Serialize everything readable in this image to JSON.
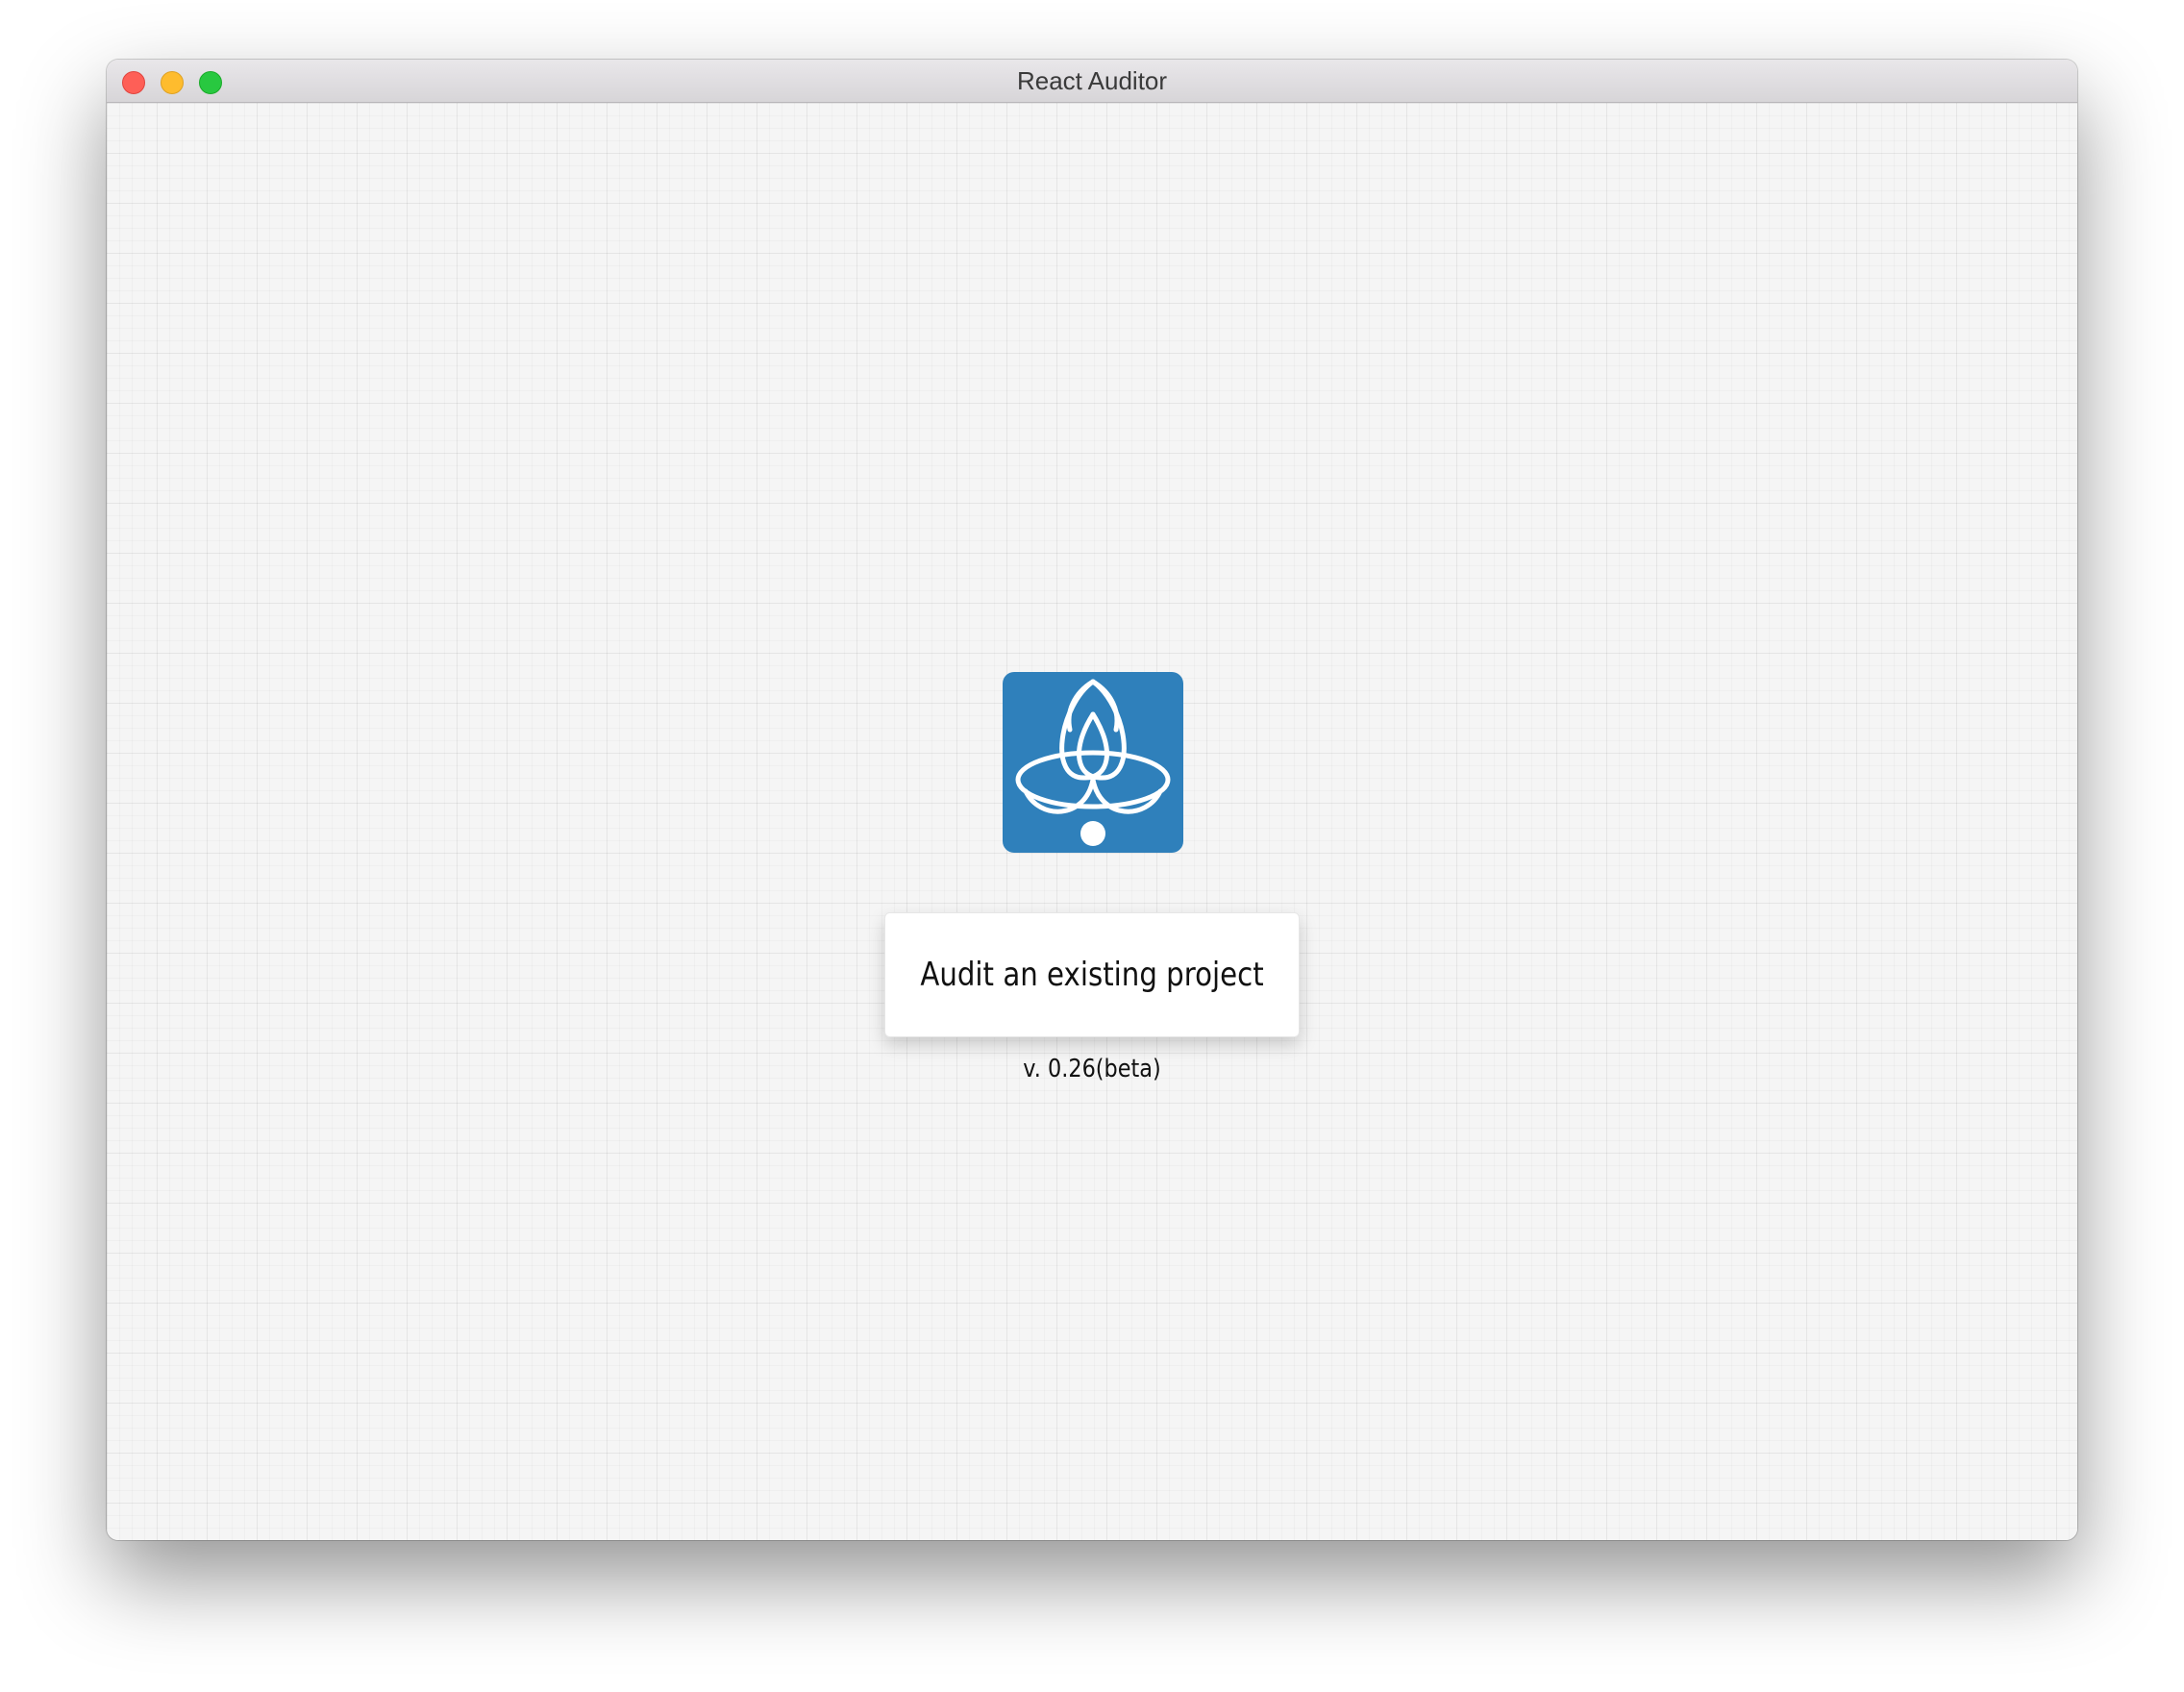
{
  "window": {
    "title": "React Auditor"
  },
  "main": {
    "logo_icon": "react-auditor-logo-icon",
    "audit_button_label": "Audit an existing project",
    "version": "v. 0.26(beta)"
  },
  "colors": {
    "logo_background": "#2f80bb",
    "close": "#fe5f57",
    "minimize": "#febc2e",
    "maximize": "#28c840"
  }
}
